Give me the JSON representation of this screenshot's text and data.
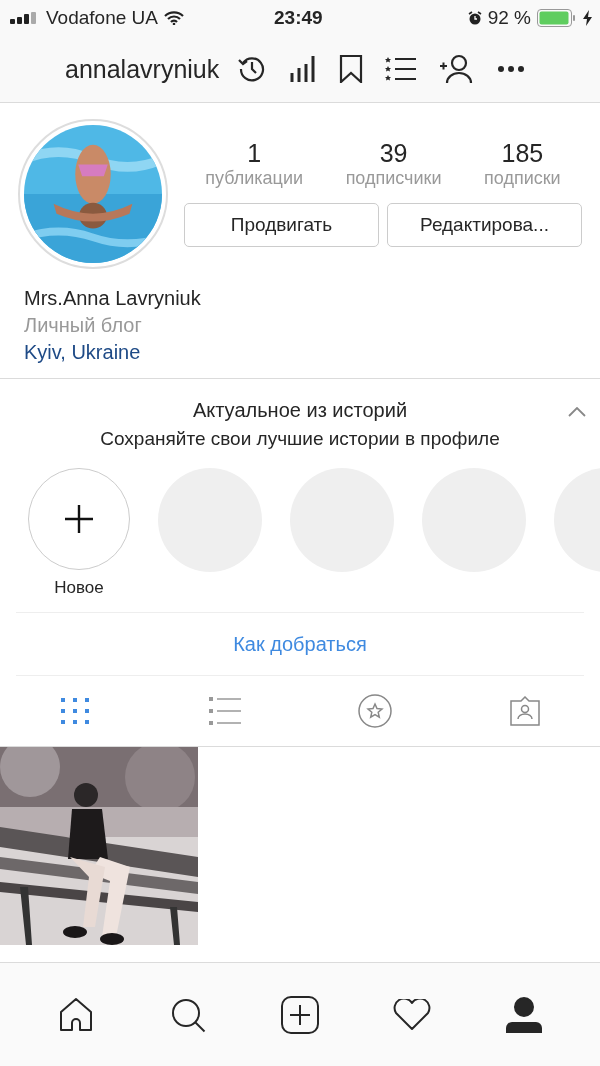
{
  "status_bar": {
    "carrier": "Vodafone UA",
    "time": "23:49",
    "battery": "92 %"
  },
  "header": {
    "username": "annalavryniuk"
  },
  "profile": {
    "stats": [
      {
        "value": "1",
        "label": "публикации"
      },
      {
        "value": "39",
        "label": "подписчики"
      },
      {
        "value": "185",
        "label": "подписки"
      }
    ],
    "buttons": [
      "Продвигать",
      "Редактирова..."
    ],
    "name": "Mrs.Anna Lavryniuk",
    "category": "Личный блог",
    "location": "Kyiv, Ukraine"
  },
  "highlights": {
    "title": "Актуальное из историй",
    "subtitle": "Сохраняйте свои лучшие истории в профиле",
    "expanded": true,
    "items": [
      {
        "kind": "new",
        "label": "Новое"
      },
      {
        "kind": "empty"
      },
      {
        "kind": "empty"
      },
      {
        "kind": "empty"
      },
      {
        "kind": "empty"
      }
    ]
  },
  "directions_link": "Как добраться",
  "tabs": [
    {
      "kind": "grid",
      "selected": true
    },
    {
      "kind": "list",
      "selected": false
    },
    {
      "kind": "star",
      "selected": false
    },
    {
      "kind": "tagged",
      "selected": false
    }
  ],
  "bottom_nav": [
    {
      "kind": "home",
      "selected": false
    },
    {
      "kind": "search",
      "selected": false
    },
    {
      "kind": "add",
      "selected": false
    },
    {
      "kind": "heart",
      "selected": false
    },
    {
      "kind": "profile",
      "selected": true
    }
  ]
}
